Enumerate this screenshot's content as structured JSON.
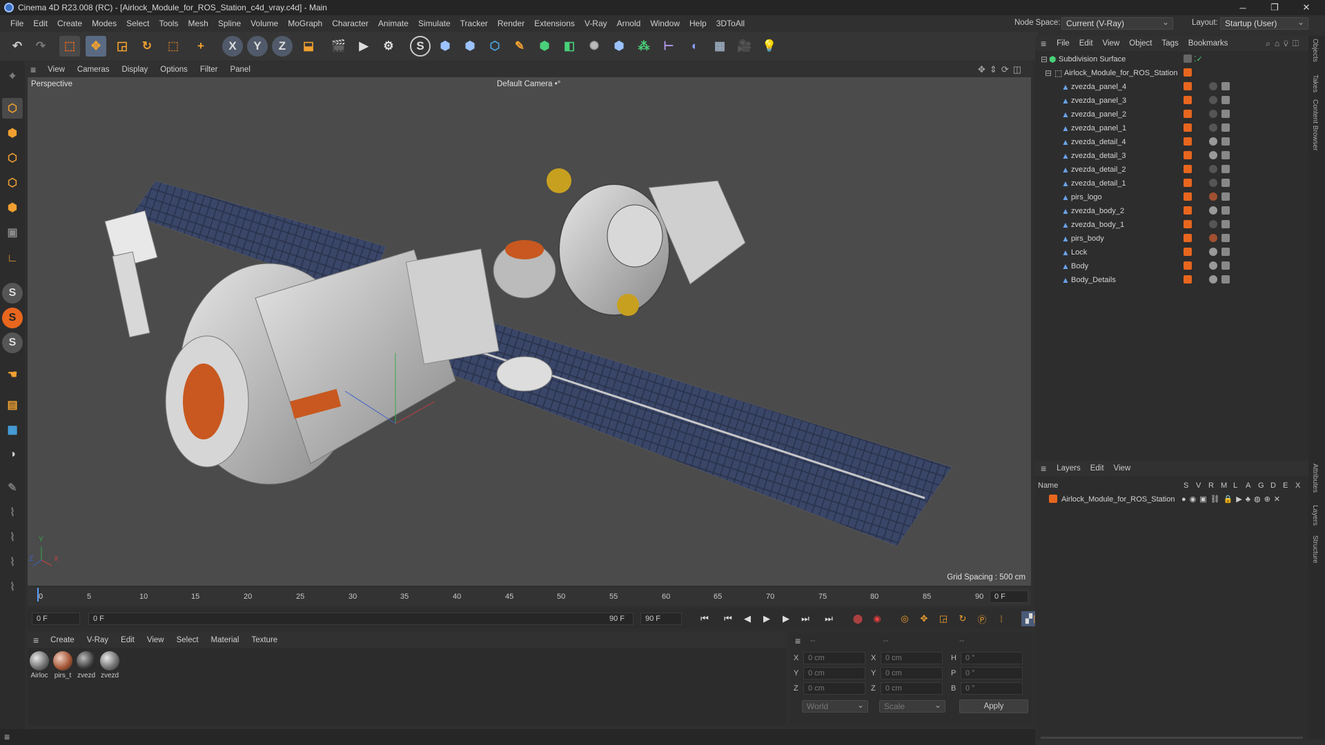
{
  "window": {
    "title": "Cinema 4D R23.008 (RC) - [Airlock_Module_for_ROS_Station_c4d_vray.c4d] - Main",
    "controls": [
      "─",
      "❐",
      "✕"
    ]
  },
  "menubar": {
    "items": [
      "File",
      "Edit",
      "Create",
      "Modes",
      "Select",
      "Tools",
      "Mesh",
      "Spline",
      "Volume",
      "MoGraph",
      "Character",
      "Animate",
      "Simulate",
      "Tracker",
      "Render",
      "Extensions",
      "V-Ray",
      "Arnold",
      "Window",
      "Help",
      "3DToAll"
    ],
    "node_space_label": "Node Space:",
    "node_space_value": "Current (V-Ray)",
    "layout_label": "Layout:",
    "layout_value": "Startup (User)"
  },
  "toolbar": {
    "icons": [
      "undo-icon",
      "redo-icon",
      "live-selection-icon",
      "move-icon",
      "scale-icon",
      "rotate-icon",
      "select-tool-icon",
      "add-icon",
      "x-axis-icon",
      "y-axis-icon",
      "z-axis-icon",
      "coordinate-system-icon",
      "render-view-icon",
      "render-icon",
      "render-settings-icon",
      "vray-icon",
      "python-icon",
      "python2-icon",
      "cube-icon",
      "pen-icon",
      "subdivision-icon",
      "extrude-icon",
      "array-icon",
      "python3-icon",
      "mograph-icon",
      "deformer-icon",
      "field-icon",
      "floor-icon",
      "camera-icon",
      "light-icon"
    ],
    "axis_labels": [
      "X",
      "Y",
      "Z"
    ]
  },
  "left_tools": [
    "model-mode-icon",
    "texture-mode-icon",
    "points-mode-icon",
    "edges-mode-icon",
    "polygons-mode-icon",
    "uv-mode-icon",
    "axis-mode-icon",
    "snap-s1-icon",
    "snap-s2-icon",
    "snap-s3-icon",
    "magnet-icon",
    "workplane-icon",
    "grid-icon",
    "locked-workplane-icon",
    "brush-icon",
    "paint-icon",
    "sculpt-icon",
    "knife-icon",
    "bridge-icon",
    "weld-icon"
  ],
  "viewport": {
    "menu": [
      "View",
      "Cameras",
      "Display",
      "Options",
      "Filter",
      "Panel"
    ],
    "label": "Perspective",
    "camera": "Default Camera",
    "camera_marker": "•°",
    "grid_spacing": "Grid Spacing : 500 cm",
    "axis_labels": {
      "x": "X",
      "y": "Y",
      "z": "Z"
    }
  },
  "timeline": {
    "ticks": [
      "0",
      "5",
      "10",
      "15",
      "20",
      "25",
      "30",
      "35",
      "40",
      "45",
      "50",
      "55",
      "60",
      "65",
      "70",
      "75",
      "80",
      "85",
      "90"
    ],
    "current_frame": "0 F",
    "frame_total": "90 F"
  },
  "playback": {
    "start_field": "0 F",
    "range_start": "0 F",
    "range_end": "90 F",
    "end_field": "90 F",
    "buttons": [
      "go-start-icon",
      "prev-key-icon",
      "prev-frame-icon",
      "play-icon",
      "next-frame-icon",
      "next-key-icon",
      "go-end-icon",
      "record-icon",
      "autokey-icon",
      "keyframe-icon",
      "move-key-icon",
      "scale-key-icon",
      "rotate-key-icon",
      "param-key-icon",
      "pla-key-icon",
      "motion-clip-icon",
      "timeline-icon"
    ]
  },
  "materials": {
    "menu": [
      "Create",
      "V-Ray",
      "Edit",
      "View",
      "Select",
      "Material",
      "Texture"
    ],
    "items": [
      "Airloc",
      "pirs_t",
      "zvezd",
      "zvezd"
    ]
  },
  "coordinates": {
    "header1": "--",
    "header2": "--",
    "header3": "--",
    "rows": [
      {
        "a": "X",
        "v1": "0 cm",
        "b": "X",
        "v2": "0 cm",
        "c": "H",
        "v3": "0 °"
      },
      {
        "a": "Y",
        "v1": "0 cm",
        "b": "Y",
        "v2": "0 cm",
        "c": "P",
        "v3": "0 °"
      },
      {
        "a": "Z",
        "v1": "0 cm",
        "b": "Z",
        "v2": "0 cm",
        "c": "B",
        "v3": "0 °"
      }
    ],
    "world": "World",
    "scale": "Scale",
    "apply": "Apply"
  },
  "objects": {
    "menu": [
      "File",
      "Edit",
      "View",
      "Object",
      "Tags",
      "Bookmarks"
    ],
    "root": "Subdivision Surface",
    "group": "Airlock_Module_for_ROS_Station",
    "children": [
      "zvezda_panel_4",
      "zvezda_panel_3",
      "zvezda_panel_2",
      "zvezda_panel_1",
      "zvezda_detail_4",
      "zvezda_detail_3",
      "zvezda_detail_2",
      "zvezda_detail_1",
      "pirs_logo",
      "zvezda_body_2",
      "zvezda_body_1",
      "pirs_body",
      "Lock",
      "Body",
      "Body_Details"
    ]
  },
  "layers": {
    "menu": [
      "Layers",
      "Edit",
      "View"
    ],
    "columns": [
      "Name",
      "S",
      "V",
      "R",
      "M",
      "L",
      "A",
      "G",
      "D",
      "E",
      "X"
    ],
    "rows": [
      "Airlock_Module_for_ROS_Station"
    ]
  },
  "side_tabs": [
    "Objects",
    "Takes",
    "Content Browser",
    "Attributes",
    "Layers",
    "Structure"
  ],
  "colors": {
    "accent": "#e8661e",
    "panel": "#2d2d2d",
    "viewport": "#4b4b4b"
  }
}
